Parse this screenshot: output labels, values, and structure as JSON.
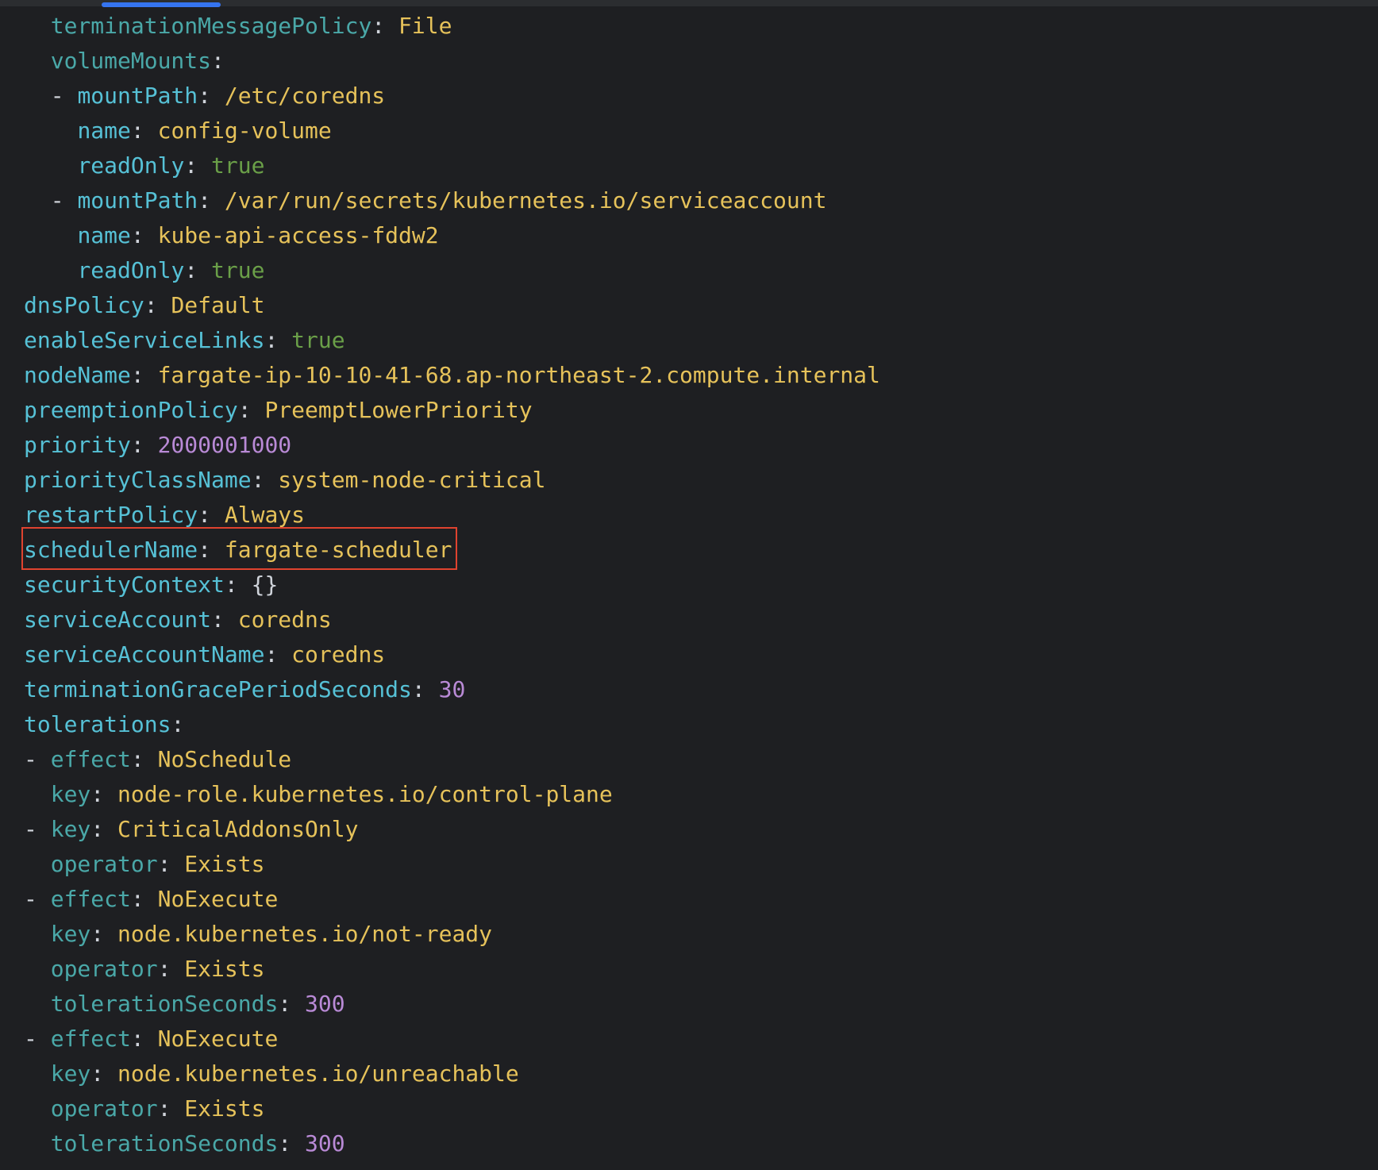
{
  "colors": {
    "background": "#1e1f22",
    "key_primary": "#56c1d6",
    "key_nested": "#4aa8a8",
    "string": "#e6c25a",
    "boolean": "#6a9f48",
    "number": "#b98ad6",
    "punctuation": "#cfd3da",
    "highlight_border": "#e0432f",
    "scroll_indicator": "#3574f0"
  },
  "lines": [
    {
      "indent": "  ",
      "dash": "",
      "key": "terminationMessagePolicy",
      "key_style": "k2",
      "value": "File",
      "value_type": "s"
    },
    {
      "indent": "  ",
      "dash": "",
      "key": "volumeMounts",
      "key_style": "k2",
      "value": "",
      "value_type": "s"
    },
    {
      "indent": "  ",
      "dash": "- ",
      "key": "mountPath",
      "key_style": "k1",
      "value": "/etc/coredns",
      "value_type": "s"
    },
    {
      "indent": "    ",
      "dash": "",
      "key": "name",
      "key_style": "k1",
      "value": "config-volume",
      "value_type": "s"
    },
    {
      "indent": "    ",
      "dash": "",
      "key": "readOnly",
      "key_style": "k1",
      "value": "true",
      "value_type": "b"
    },
    {
      "indent": "  ",
      "dash": "- ",
      "key": "mountPath",
      "key_style": "k1",
      "value": "/var/run/secrets/kubernetes.io/serviceaccount",
      "value_type": "s"
    },
    {
      "indent": "    ",
      "dash": "",
      "key": "name",
      "key_style": "k1",
      "value": "kube-api-access-fddw2",
      "value_type": "s"
    },
    {
      "indent": "    ",
      "dash": "",
      "key": "readOnly",
      "key_style": "k1",
      "value": "true",
      "value_type": "b"
    },
    {
      "indent": "",
      "dash": "",
      "key": "dnsPolicy",
      "key_style": "k1",
      "value": "Default",
      "value_type": "s"
    },
    {
      "indent": "",
      "dash": "",
      "key": "enableServiceLinks",
      "key_style": "k1",
      "value": "true",
      "value_type": "b"
    },
    {
      "indent": "",
      "dash": "",
      "key": "nodeName",
      "key_style": "k1",
      "value": "fargate-ip-10-10-41-68.ap-northeast-2.compute.internal",
      "value_type": "s"
    },
    {
      "indent": "",
      "dash": "",
      "key": "preemptionPolicy",
      "key_style": "k1",
      "value": "PreemptLowerPriority",
      "value_type": "s"
    },
    {
      "indent": "",
      "dash": "",
      "key": "priority",
      "key_style": "k1",
      "value": "2000001000",
      "value_type": "n"
    },
    {
      "indent": "",
      "dash": "",
      "key": "priorityClassName",
      "key_style": "k1",
      "value": "system-node-critical",
      "value_type": "s"
    },
    {
      "indent": "",
      "dash": "",
      "key": "restartPolicy",
      "key_style": "k1",
      "value": "Always",
      "value_type": "s"
    },
    {
      "indent": "",
      "dash": "",
      "key": "schedulerName",
      "key_style": "k1",
      "value": "fargate-scheduler",
      "value_type": "s"
    },
    {
      "indent": "",
      "dash": "",
      "key": "securityContext",
      "key_style": "k1",
      "value": "{}",
      "value_type": "p"
    },
    {
      "indent": "",
      "dash": "",
      "key": "serviceAccount",
      "key_style": "k1",
      "value": "coredns",
      "value_type": "s"
    },
    {
      "indent": "",
      "dash": "",
      "key": "serviceAccountName",
      "key_style": "k1",
      "value": "coredns",
      "value_type": "s"
    },
    {
      "indent": "",
      "dash": "",
      "key": "terminationGracePeriodSeconds",
      "key_style": "k1",
      "value": "30",
      "value_type": "n"
    },
    {
      "indent": "",
      "dash": "",
      "key": "tolerations",
      "key_style": "k1",
      "value": "",
      "value_type": "s"
    },
    {
      "indent": "",
      "dash": "- ",
      "key": "effect",
      "key_style": "k2",
      "value": "NoSchedule",
      "value_type": "s"
    },
    {
      "indent": "  ",
      "dash": "",
      "key": "key",
      "key_style": "k2",
      "value": "node-role.kubernetes.io/control-plane",
      "value_type": "s"
    },
    {
      "indent": "",
      "dash": "- ",
      "key": "key",
      "key_style": "k2",
      "value": "CriticalAddonsOnly",
      "value_type": "s"
    },
    {
      "indent": "  ",
      "dash": "",
      "key": "operator",
      "key_style": "k2",
      "value": "Exists",
      "value_type": "s"
    },
    {
      "indent": "",
      "dash": "- ",
      "key": "effect",
      "key_style": "k2",
      "value": "NoExecute",
      "value_type": "s"
    },
    {
      "indent": "  ",
      "dash": "",
      "key": "key",
      "key_style": "k2",
      "value": "node.kubernetes.io/not-ready",
      "value_type": "s"
    },
    {
      "indent": "  ",
      "dash": "",
      "key": "operator",
      "key_style": "k2",
      "value": "Exists",
      "value_type": "s"
    },
    {
      "indent": "  ",
      "dash": "",
      "key": "tolerationSeconds",
      "key_style": "k2",
      "value": "300",
      "value_type": "n"
    },
    {
      "indent": "",
      "dash": "- ",
      "key": "effect",
      "key_style": "k2",
      "value": "NoExecute",
      "value_type": "s"
    },
    {
      "indent": "  ",
      "dash": "",
      "key": "key",
      "key_style": "k2",
      "value": "node.kubernetes.io/unreachable",
      "value_type": "s"
    },
    {
      "indent": "  ",
      "dash": "",
      "key": "operator",
      "key_style": "k2",
      "value": "Exists",
      "value_type": "s"
    },
    {
      "indent": "  ",
      "dash": "",
      "key": "tolerationSeconds",
      "key_style": "k2",
      "value": "300",
      "value_type": "n"
    }
  ]
}
